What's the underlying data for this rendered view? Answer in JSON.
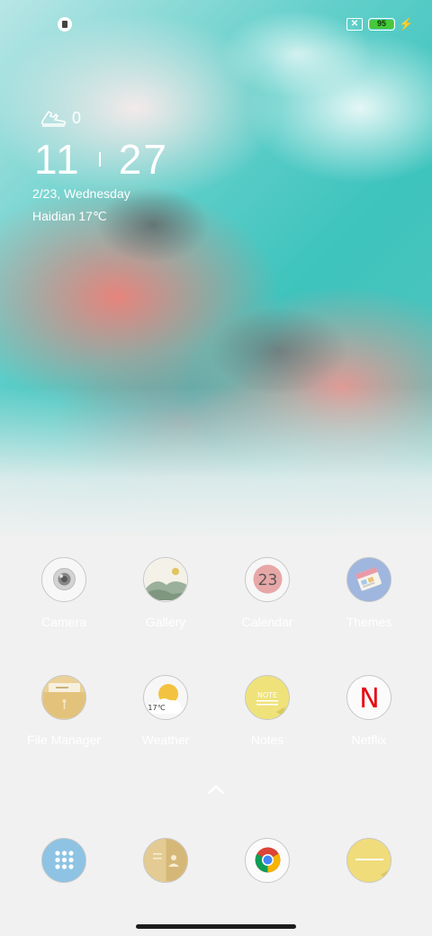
{
  "status_bar": {
    "app_icon": "notification-app-icon",
    "sim_icon": "no-sim-icon",
    "battery_level": "95",
    "battery_color": "#46c93a",
    "charging_icon": "lightning-bolt-icon"
  },
  "lock_widget": {
    "steps_icon": "sneaker-icon",
    "steps": "0",
    "time_hour": "11",
    "time_minute": "27",
    "date": "2/23, Wednesday",
    "weather": "Haidian 17℃"
  },
  "apps": [
    {
      "label": "Camera",
      "icon": "camera-icon"
    },
    {
      "label": "Gallery",
      "icon": "gallery-icon"
    },
    {
      "label": "Calendar",
      "icon": "calendar-icon",
      "badge": "23"
    },
    {
      "label": "Themes",
      "icon": "themes-icon"
    },
    {
      "label": "File Manager",
      "icon": "folder-icon"
    },
    {
      "label": "Weather",
      "icon": "weather-icon",
      "badge": "17℃"
    },
    {
      "label": "Notes",
      "icon": "notes-icon",
      "badge": "NOTE"
    },
    {
      "label": "Netflix",
      "icon": "netflix-icon",
      "badge": "N"
    }
  ],
  "dock": [
    {
      "icon": "app-drawer-icon"
    },
    {
      "icon": "contacts-icon"
    },
    {
      "icon": "chrome-icon"
    },
    {
      "icon": "messages-icon"
    }
  ],
  "colors": {
    "netflix_red": "#e50914",
    "accent_yellow": "#f0dc7a"
  }
}
